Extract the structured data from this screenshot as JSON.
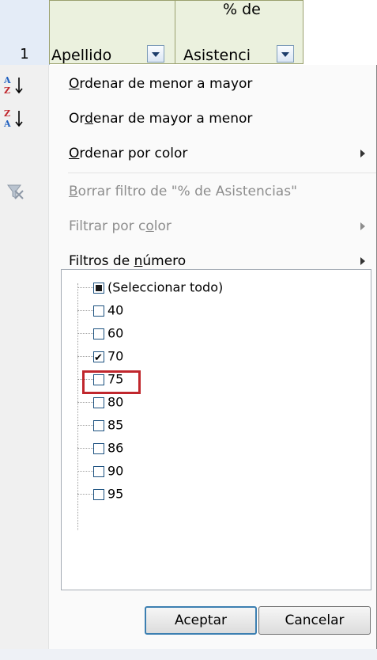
{
  "sheet": {
    "row_number": "1",
    "column_a_label": "Apellido",
    "column_b_label_line1": "% de",
    "column_b_label_line2": "Asistenci"
  },
  "menu": {
    "sort_asc": {
      "pre": "",
      "u": "O",
      "post": "rdenar de menor a mayor",
      "icon": "sort-ascending-icon"
    },
    "sort_desc": {
      "pre": "Or",
      "u": "d",
      "post": "enar de mayor a menor",
      "icon": "sort-descending-icon"
    },
    "sort_color": {
      "pre": "",
      "u": "O",
      "post": "rdenar por color"
    },
    "clear_filter": {
      "pre": "",
      "u": "B",
      "post": "orrar filtro de \"% de Asistencias\"",
      "icon": "clear-filter-icon"
    },
    "filter_color": {
      "pre": "Filtrar por c",
      "u": "o",
      "post": "lor"
    },
    "number_filters": {
      "pre": "Filtros de ",
      "u": "n",
      "post": "úmero"
    }
  },
  "checklist": {
    "items": [
      {
        "label": "(Seleccionar todo)",
        "state": "indeterminate"
      },
      {
        "label": "40",
        "state": "unchecked"
      },
      {
        "label": "60",
        "state": "unchecked"
      },
      {
        "label": "70",
        "state": "checked"
      },
      {
        "label": "75",
        "state": "unchecked"
      },
      {
        "label": "80",
        "state": "unchecked"
      },
      {
        "label": "85",
        "state": "unchecked"
      },
      {
        "label": "86",
        "state": "unchecked"
      },
      {
        "label": "90",
        "state": "unchecked"
      },
      {
        "label": "95",
        "state": "unchecked"
      }
    ]
  },
  "buttons": {
    "ok": "Aceptar",
    "cancel": "Cancelar"
  },
  "colors": {
    "highlight": "#c0272d",
    "header_fill": "#ebf1de"
  }
}
